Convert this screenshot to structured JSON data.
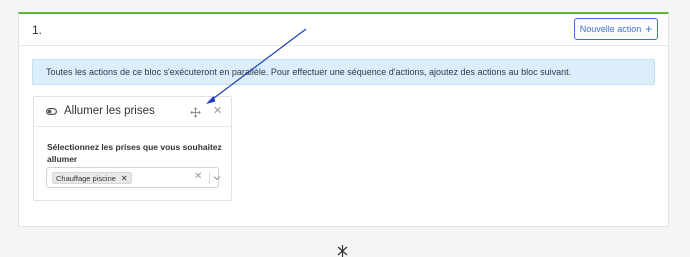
{
  "block": {
    "number": "1.",
    "new_action_label": "Nouvelle action",
    "accent_color": "#5bb936"
  },
  "info_banner": {
    "text": "Toutes les actions de ce bloc s'exécuteront en parallèle. Pour effectuer une séquence d'actions, ajoutez des actions au bloc suivant."
  },
  "action_card": {
    "title": "Allumer les prises",
    "icons": [
      "toggle-icon",
      "move-icon",
      "close-icon"
    ],
    "field_label": "Sélectionnez les prises que vous souhaitez allumer",
    "select": {
      "selected_tags": [
        "Chauffage piscine"
      ],
      "icons": [
        "clear-icon",
        "chevron-down-icon"
      ]
    }
  },
  "colors": {
    "primary": "#3d6fd0",
    "info_bg": "#dbeef9",
    "annotation": "#1f3fbf"
  }
}
